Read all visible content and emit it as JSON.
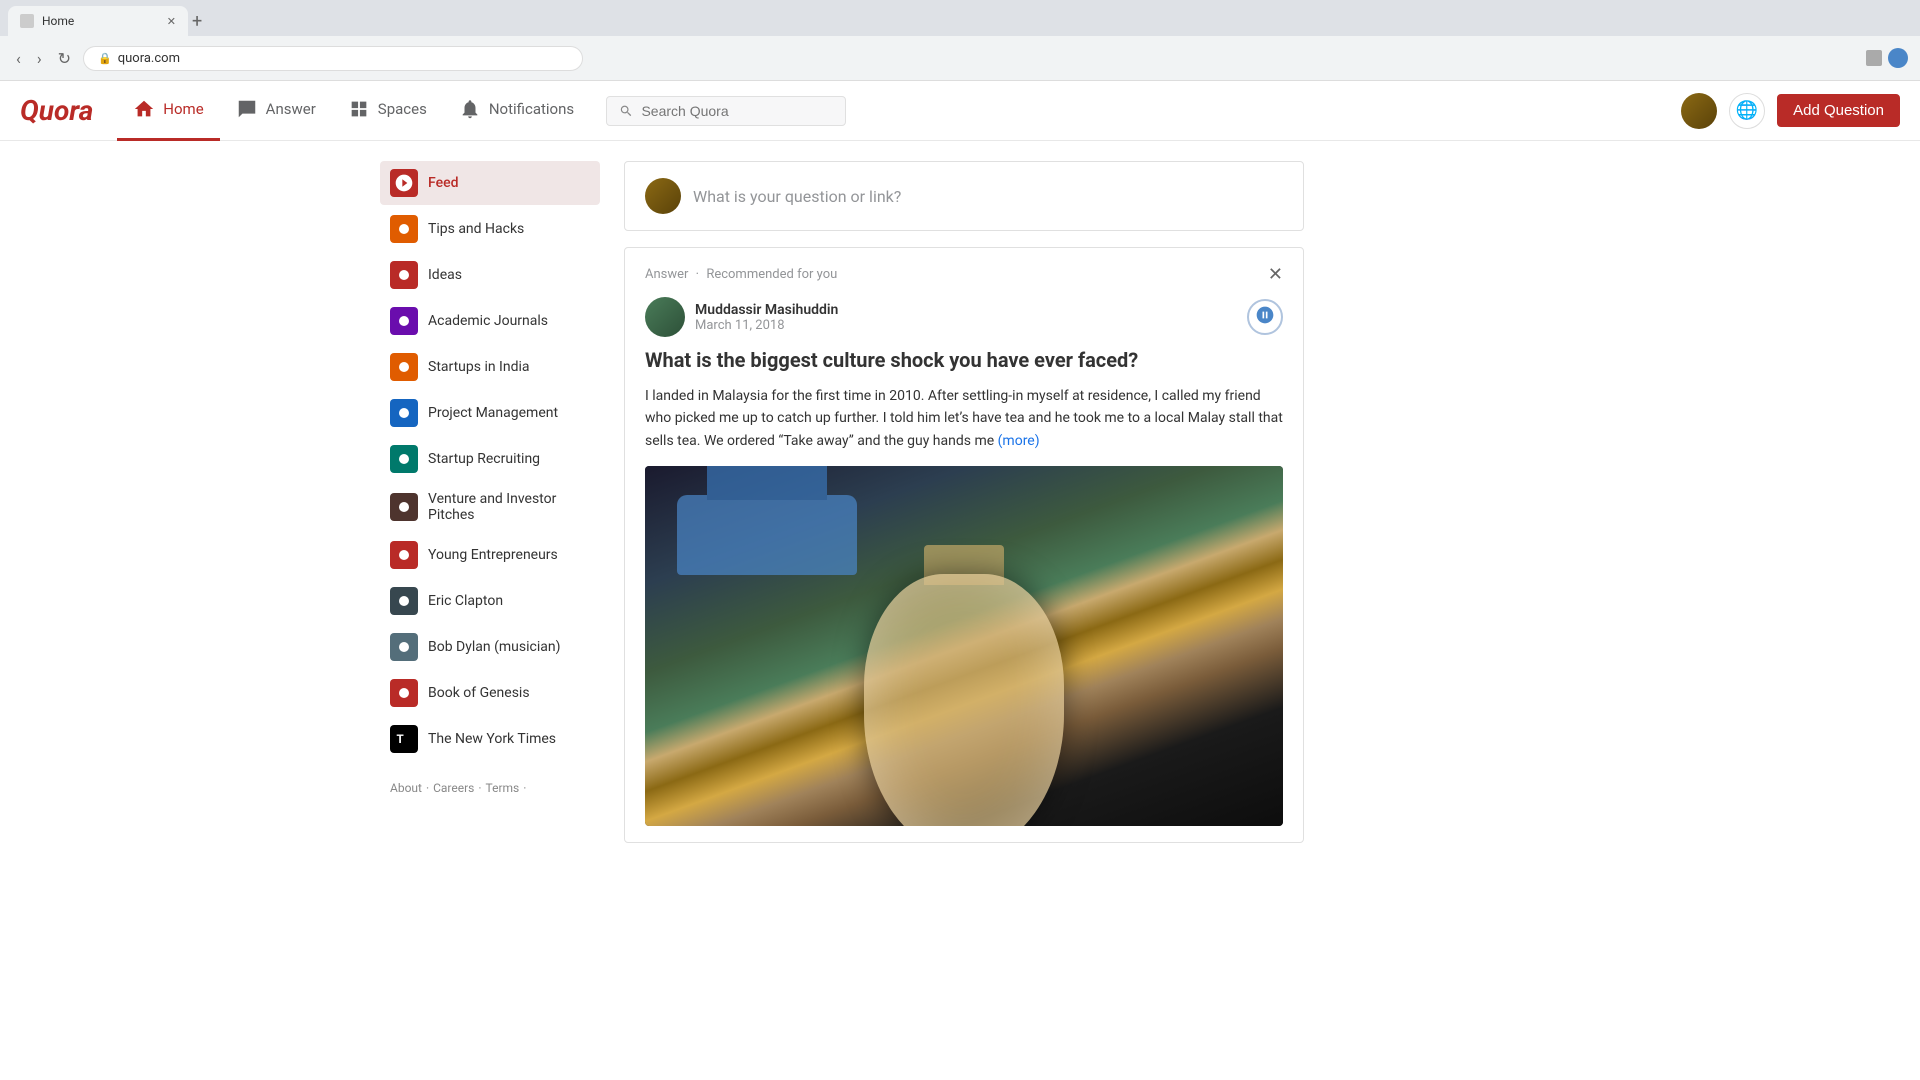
{
  "browser": {
    "tab_title": "Home",
    "tab_new_label": "+",
    "url": "quora.com",
    "nav_back": "‹",
    "nav_forward": "›",
    "nav_refresh": "↻"
  },
  "header": {
    "logo": "Quora",
    "nav": [
      {
        "id": "home",
        "label": "Home",
        "active": true
      },
      {
        "id": "answer",
        "label": "Answer",
        "active": false
      },
      {
        "id": "spaces",
        "label": "Spaces",
        "active": false
      },
      {
        "id": "notifications",
        "label": "Notifications",
        "active": false
      }
    ],
    "search_placeholder": "Search Quora",
    "add_question_label": "Add Question"
  },
  "sidebar": {
    "items": [
      {
        "id": "feed",
        "label": "Feed",
        "active": true,
        "color": "red"
      },
      {
        "id": "tips-hacks",
        "label": "Tips and Hacks",
        "active": false,
        "color": "orange"
      },
      {
        "id": "ideas",
        "label": "Ideas",
        "active": false,
        "color": "red"
      },
      {
        "id": "academic-journals",
        "label": "Academic Journals",
        "active": false,
        "color": "purple"
      },
      {
        "id": "startups-india",
        "label": "Startups in India",
        "active": false,
        "color": "orange"
      },
      {
        "id": "project-management",
        "label": "Project Management",
        "active": false,
        "color": "blue"
      },
      {
        "id": "startup-recruiting",
        "label": "Startup Recruiting",
        "active": false,
        "color": "teal"
      },
      {
        "id": "venture-investor",
        "label": "Venture and Investor Pitches",
        "active": false,
        "color": "brown"
      },
      {
        "id": "young-entrepreneurs",
        "label": "Young Entrepreneurs",
        "active": false,
        "color": "red"
      },
      {
        "id": "eric-clapton",
        "label": "Eric Clapton",
        "active": false,
        "color": "darkgray"
      },
      {
        "id": "bob-dylan",
        "label": "Bob Dylan (musician)",
        "active": false,
        "color": "gray"
      },
      {
        "id": "book-genesis",
        "label": "Book of Genesis",
        "active": false,
        "color": "red"
      },
      {
        "id": "nyt",
        "label": "The New York Times",
        "active": false,
        "color": "nyt"
      }
    ],
    "footer": [
      "About",
      "Careers",
      "Terms"
    ]
  },
  "ask_box": {
    "placeholder": "What is your question or link?"
  },
  "feed_card": {
    "meta_label": "Answer",
    "meta_recommended": "Recommended for you",
    "author_name": "Muddassir Masihuddin",
    "author_date": "March 11, 2018",
    "question": "What is the biggest culture shock you have ever faced?",
    "answer_text": "I landed in Malaysia for the first time in 2010. After settling-in myself at residence, I called my friend who picked me up to catch up further. I told him let’s have tea and he took me to a local Malay stall that sells tea. We ordered “Take away” and the guy hands me",
    "more_label": "(more)"
  }
}
